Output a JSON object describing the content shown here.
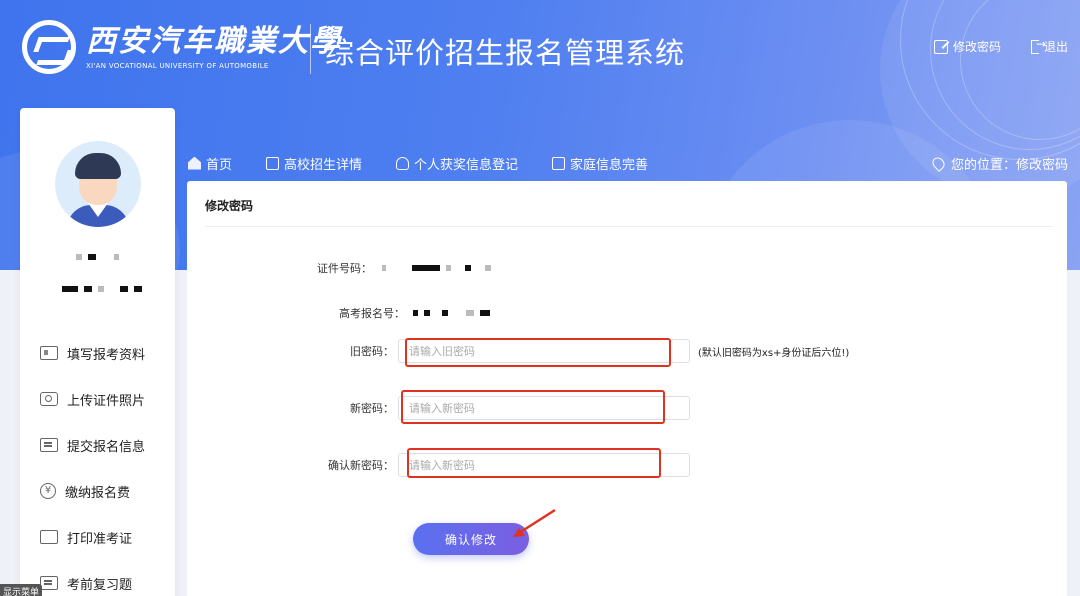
{
  "header": {
    "logo_cn": "西安汽车職業大學",
    "logo_en": "XI'AN VOCATIONAL UNIVERSITY OF AUTOMOBILE",
    "system_title": "综合评价招生报名管理系统",
    "change_password": "修改密码",
    "logout": "退出"
  },
  "nav": {
    "items": [
      {
        "label": "首页"
      },
      {
        "label": "高校招生详情"
      },
      {
        "label": "个人获奖信息登记"
      },
      {
        "label": "家庭信息完善"
      }
    ],
    "location": "您的位置：修改密码"
  },
  "sidebar": {
    "menu": [
      {
        "label": "填写报考资料"
      },
      {
        "label": "上传证件照片"
      },
      {
        "label": "提交报名信息"
      },
      {
        "label": "缴纳报名费"
      },
      {
        "label": "打印准考证"
      },
      {
        "label": "考前复习题"
      }
    ],
    "hint": "显示菜单"
  },
  "panel": {
    "title": "修改密码",
    "id_label": "证件号码：",
    "exam_label": "高考报名号：",
    "old_label": "旧密码：",
    "old_placeholder": "请输入旧密码",
    "old_note": "(默认旧密码为xs+身份证后六位!)",
    "new_label": "新密码：",
    "new_placeholder": "请输入新密码",
    "confirm_label": "确认新密码：",
    "confirm_placeholder": "请输入新密码",
    "submit": "确认修改"
  },
  "colors": {
    "banner": "#4f7ff0",
    "highlight": "#e0321f",
    "button": "#6a67ea"
  }
}
